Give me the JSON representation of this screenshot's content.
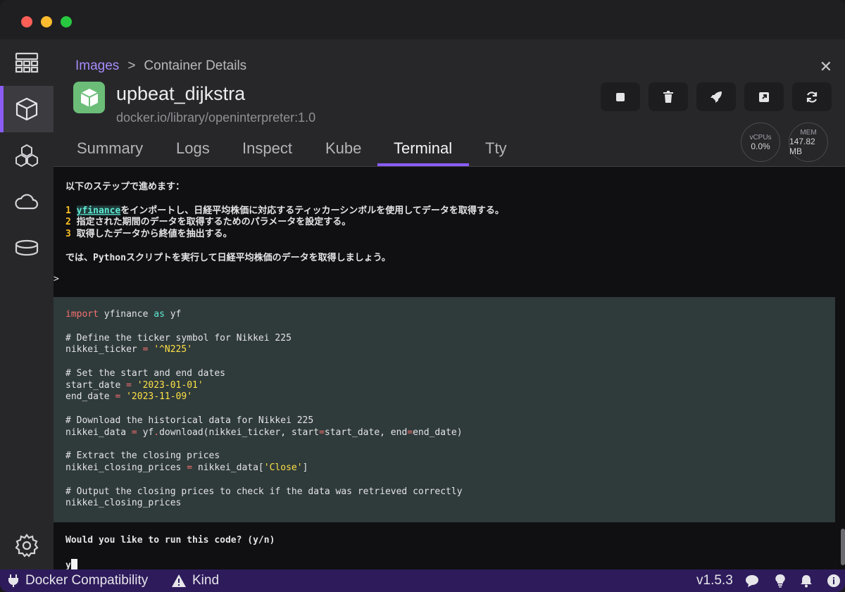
{
  "breadcrumb": {
    "parent": "Images",
    "separator": ">",
    "current": "Container Details"
  },
  "container": {
    "name": "upbeat_dijkstra",
    "image": "docker.io/library/openinterpreter:1.0"
  },
  "stats": {
    "cpu": {
      "label": "vCPUs",
      "value": "0.0%"
    },
    "mem": {
      "label": "MEM",
      "value": "147.82 MB"
    }
  },
  "tabs": [
    {
      "label": "Summary"
    },
    {
      "label": "Logs"
    },
    {
      "label": "Inspect"
    },
    {
      "label": "Kube"
    },
    {
      "label": "Terminal",
      "active": true
    },
    {
      "label": "Tty"
    }
  ],
  "terminal": {
    "intro": "以下のステップで進めます：",
    "steps": [
      {
        "n": "1",
        "highlight": "yfinance",
        "text": "をインポートし、日経平均株価に対応するティッカーシンボルを使用してデータを取得する。"
      },
      {
        "n": "2",
        "text": "指定された期間のデータを取得するためのパラメータを設定する。"
      },
      {
        "n": "3",
        "text": "取得したデータから終値を抽出する。"
      }
    ],
    "outro": "では、Pythonスクリプトを実行して日経平均株価のデータを取得しましょう。",
    "prompt": ">",
    "code": {
      "l1_kw": "import",
      "l1_mod": " yfinance ",
      "l1_as": "as",
      "l1_alias": " yf",
      "c1": "# Define the ticker symbol for Nikkei 225",
      "l2_var": "nikkei_ticker ",
      "l2_eq": "=",
      "l2_val": " '^N225'",
      "c2": "# Set the start and end dates",
      "l3_var": "start_date ",
      "l3_eq": "=",
      "l3_val": " '2023-01-01'",
      "l4_var": "end_date ",
      "l4_eq": "=",
      "l4_val": " '2023-11-09'",
      "c3": "# Download the historical data for Nikkei 225",
      "l5_a": "nikkei_data ",
      "l5_eq": "=",
      "l5_b": " yf",
      "l5_dot": ".",
      "l5_c": "download(nikkei_ticker, start",
      "l5_eq2": "=",
      "l5_d": "start_date, end",
      "l5_eq3": "=",
      "l5_e": "end_date)",
      "c4": "# Extract the closing prices",
      "l6_a": "nikkei_closing_prices ",
      "l6_eq": "=",
      "l6_b": " nikkei_data[",
      "l6_str": "'Close'",
      "l6_c": "]",
      "c5": "# Output the closing prices to check if the data was retrieved correctly",
      "l7": "nikkei_closing_prices"
    },
    "question": "Would you like to run this code? (y/n)",
    "answer": "y"
  },
  "statusbar": {
    "compat": "Docker Compatibility",
    "kind": "Kind",
    "version": "v1.5.3"
  },
  "colors": {
    "accent": "#8b5cf6",
    "statusbar": "#2e1b5c",
    "container_icon": "#6bbd78"
  }
}
